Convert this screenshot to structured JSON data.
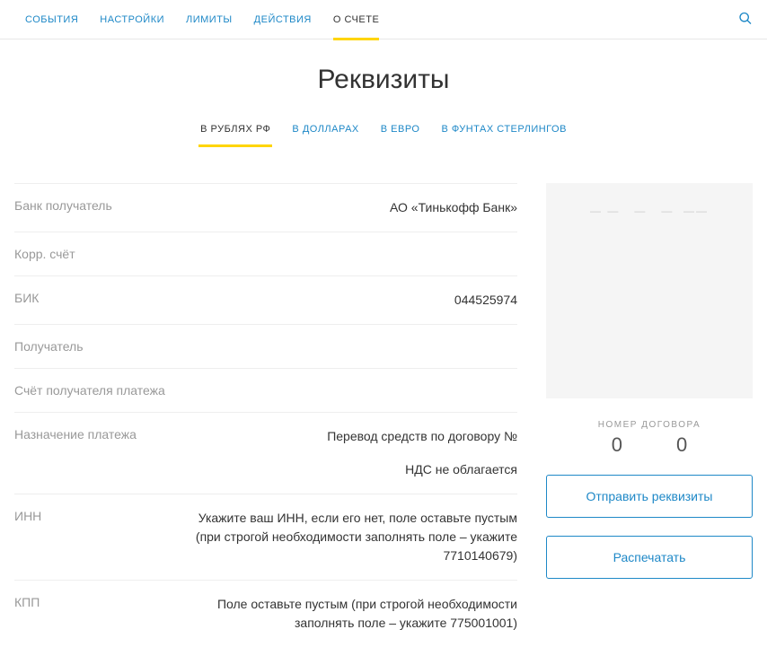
{
  "topNav": {
    "items": [
      {
        "label": "СОБЫТИЯ"
      },
      {
        "label": "НАСТРОЙКИ"
      },
      {
        "label": "ЛИМИТЫ"
      },
      {
        "label": "ДЕЙСТВИЯ"
      },
      {
        "label": "О СЧЕТЕ"
      }
    ]
  },
  "pageTitle": "Реквизиты",
  "subTabs": {
    "items": [
      {
        "label": "В РУБЛЯХ РФ"
      },
      {
        "label": "В ДОЛЛАРАХ"
      },
      {
        "label": "В ЕВРО"
      },
      {
        "label": "В ФУНТАХ СТЕРЛИНГОВ"
      }
    ]
  },
  "details": {
    "bank_recipient_label": "Банк получатель",
    "bank_recipient_value": "АО «Тинькофф Банк»",
    "corr_account_label": "Корр. счёт",
    "corr_account_value": "",
    "bic_label": "БИК",
    "bic_value": "044525974",
    "recipient_label": "Получатель",
    "recipient_value": "",
    "recipient_account_label": "Счёт получателя платежа",
    "recipient_account_value": "",
    "purpose_label": "Назначение платежа",
    "purpose_value_line1": "Перевод средств по договору №",
    "purpose_value_line2": "НДС не облагается",
    "inn_label": "ИНН",
    "inn_value": "Укажите ваш ИНН, если его нет, поле оставьте пустым (при строгой необходимости заполнять поле – укажите 7710140679)",
    "kpp_label": "КПП",
    "kpp_value": "Поле оставьте пустым (при строгой необходимости заполнять поле – укажите 775001001)"
  },
  "side": {
    "contract_label": "НОМЕР ДОГОВОРА",
    "contract_d1": "0",
    "contract_d2": "0",
    "send_btn": "Отправить реквизиты",
    "print_btn": "Распечатать"
  }
}
